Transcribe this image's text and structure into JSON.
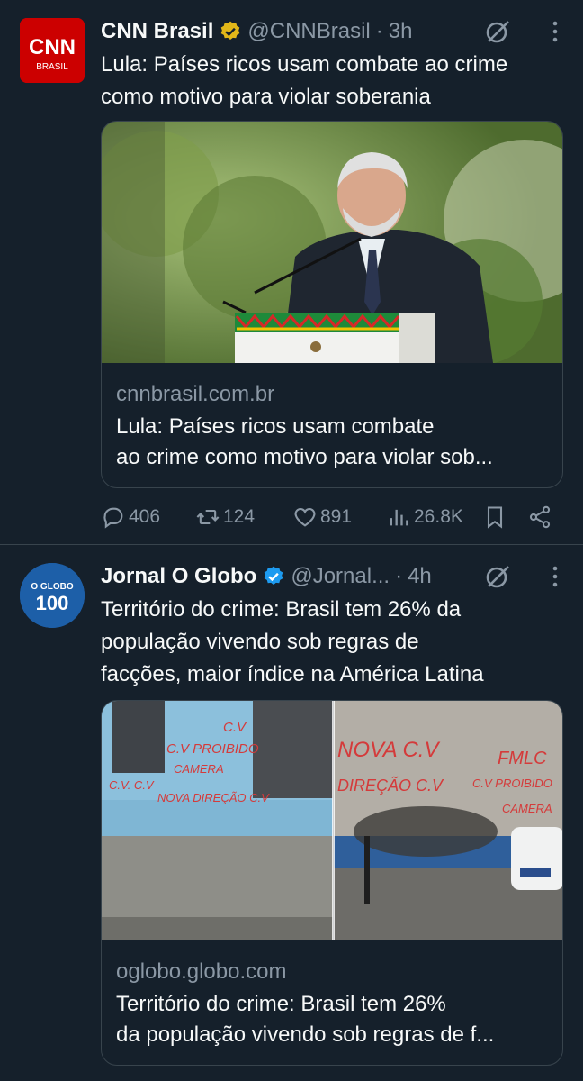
{
  "tweets": [
    {
      "name": "CNN Brasil",
      "handle": "@CNNBrasil",
      "separator": "·",
      "time": "3h",
      "avatar_text_top": "CNN",
      "avatar_text_bottom": "BRASIL",
      "text_lines": [
        "Lula: Países ricos usam combate ao crime",
        "como motivo para violar soberania"
      ],
      "card": {
        "domain": "cnnbrasil.com.br",
        "title_lines": [
          "Lula: Países ricos usam combate",
          "ao crime como motivo para violar sob..."
        ]
      },
      "stats": {
        "replies": "406",
        "reposts": "124",
        "likes": "891",
        "views": "26.8K"
      }
    },
    {
      "name": "Jornal O Globo",
      "handle": "@Jornal...",
      "separator": "·",
      "time": "4h",
      "avatar_text_top": "O GLOBO",
      "avatar_text_bottom": "100",
      "text_lines": [
        "Território do crime: Brasil tem 26% da",
        "população vivendo sob regras de",
        "facções, maior índice na América Latina"
      ],
      "card": {
        "domain": "oglobo.globo.com",
        "title_lines": [
          "Território do crime: Brasil tem 26%",
          "da população vivendo sob regras de f..."
        ],
        "graffiti_left": [
          "C.V",
          "C.V PROIBIDO",
          "CAMERA",
          "C.V. C.V",
          "NOVA DIREÇÃO C.V"
        ],
        "graffiti_right": [
          "NOVA C.V",
          "DIREÇÃO C.V",
          "FMLC",
          "C.V PROIBIDO",
          "CAMERA"
        ]
      }
    }
  ],
  "colors": {
    "background": "#15202b",
    "divider": "#38444d",
    "secondary_text": "#8b98a5",
    "verified_gold": "#e2b719",
    "verified_blue": "#1d9bf0"
  },
  "icons": [
    "verified-badge-icon",
    "grok-icon",
    "more-icon",
    "reply-icon",
    "repost-icon",
    "like-icon",
    "views-icon",
    "bookmark-icon",
    "share-icon"
  ]
}
